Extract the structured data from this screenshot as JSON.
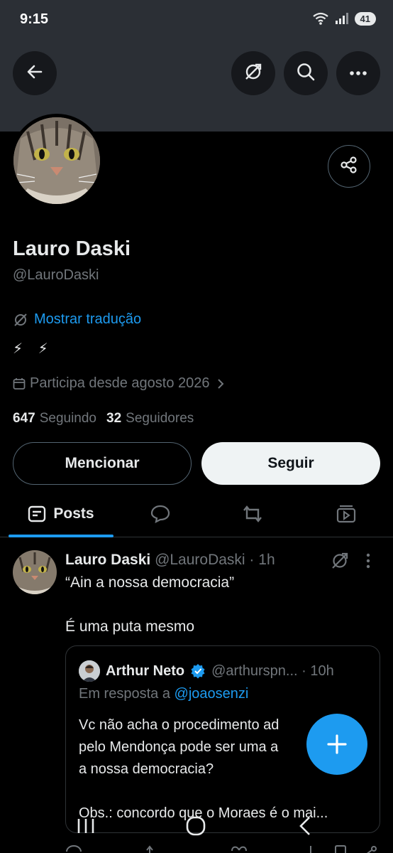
{
  "status": {
    "time": "9:15",
    "battery": "41",
    "signal_badge": "5"
  },
  "header": {
    "back": "back-arrow-icon",
    "translate": "translate-icon",
    "search": "search-icon",
    "more": "more-icon"
  },
  "profile": {
    "name": "Lauro Daski",
    "handle": "@LauroDaski",
    "translate_label": "Mostrar tradução",
    "bio": "⚡ ⚡",
    "joined": "Participa desde agosto 2026",
    "following_count": "647",
    "following_label": "Seguindo",
    "followers_count": "32",
    "followers_label": "Seguidores",
    "mention_label": "Mencionar",
    "follow_label": "Seguir"
  },
  "tabs": {
    "posts_label": "Posts"
  },
  "post": {
    "author": "Lauro Daski",
    "meta": "@LauroDaski · 1h",
    "line1": "“Ain a nossa democracia”",
    "line2": "É uma puta mesmo",
    "quote": {
      "author": "Arthur Neto",
      "meta": "@arthurspn... · 10h",
      "reply_prefix": "Em resposta a ",
      "reply_to": "@joaosenzi",
      "body": "Vc não acha o procedimento ad\npelo Mendonça pode ser uma a\na nossa democracia?\n\nObs.: concordo que o Moraes é o mai..."
    }
  },
  "colors": {
    "accent": "#1d9bf0",
    "banner": "#2b2f35",
    "muted": "#71767b",
    "verified": "#1d9bf0"
  }
}
